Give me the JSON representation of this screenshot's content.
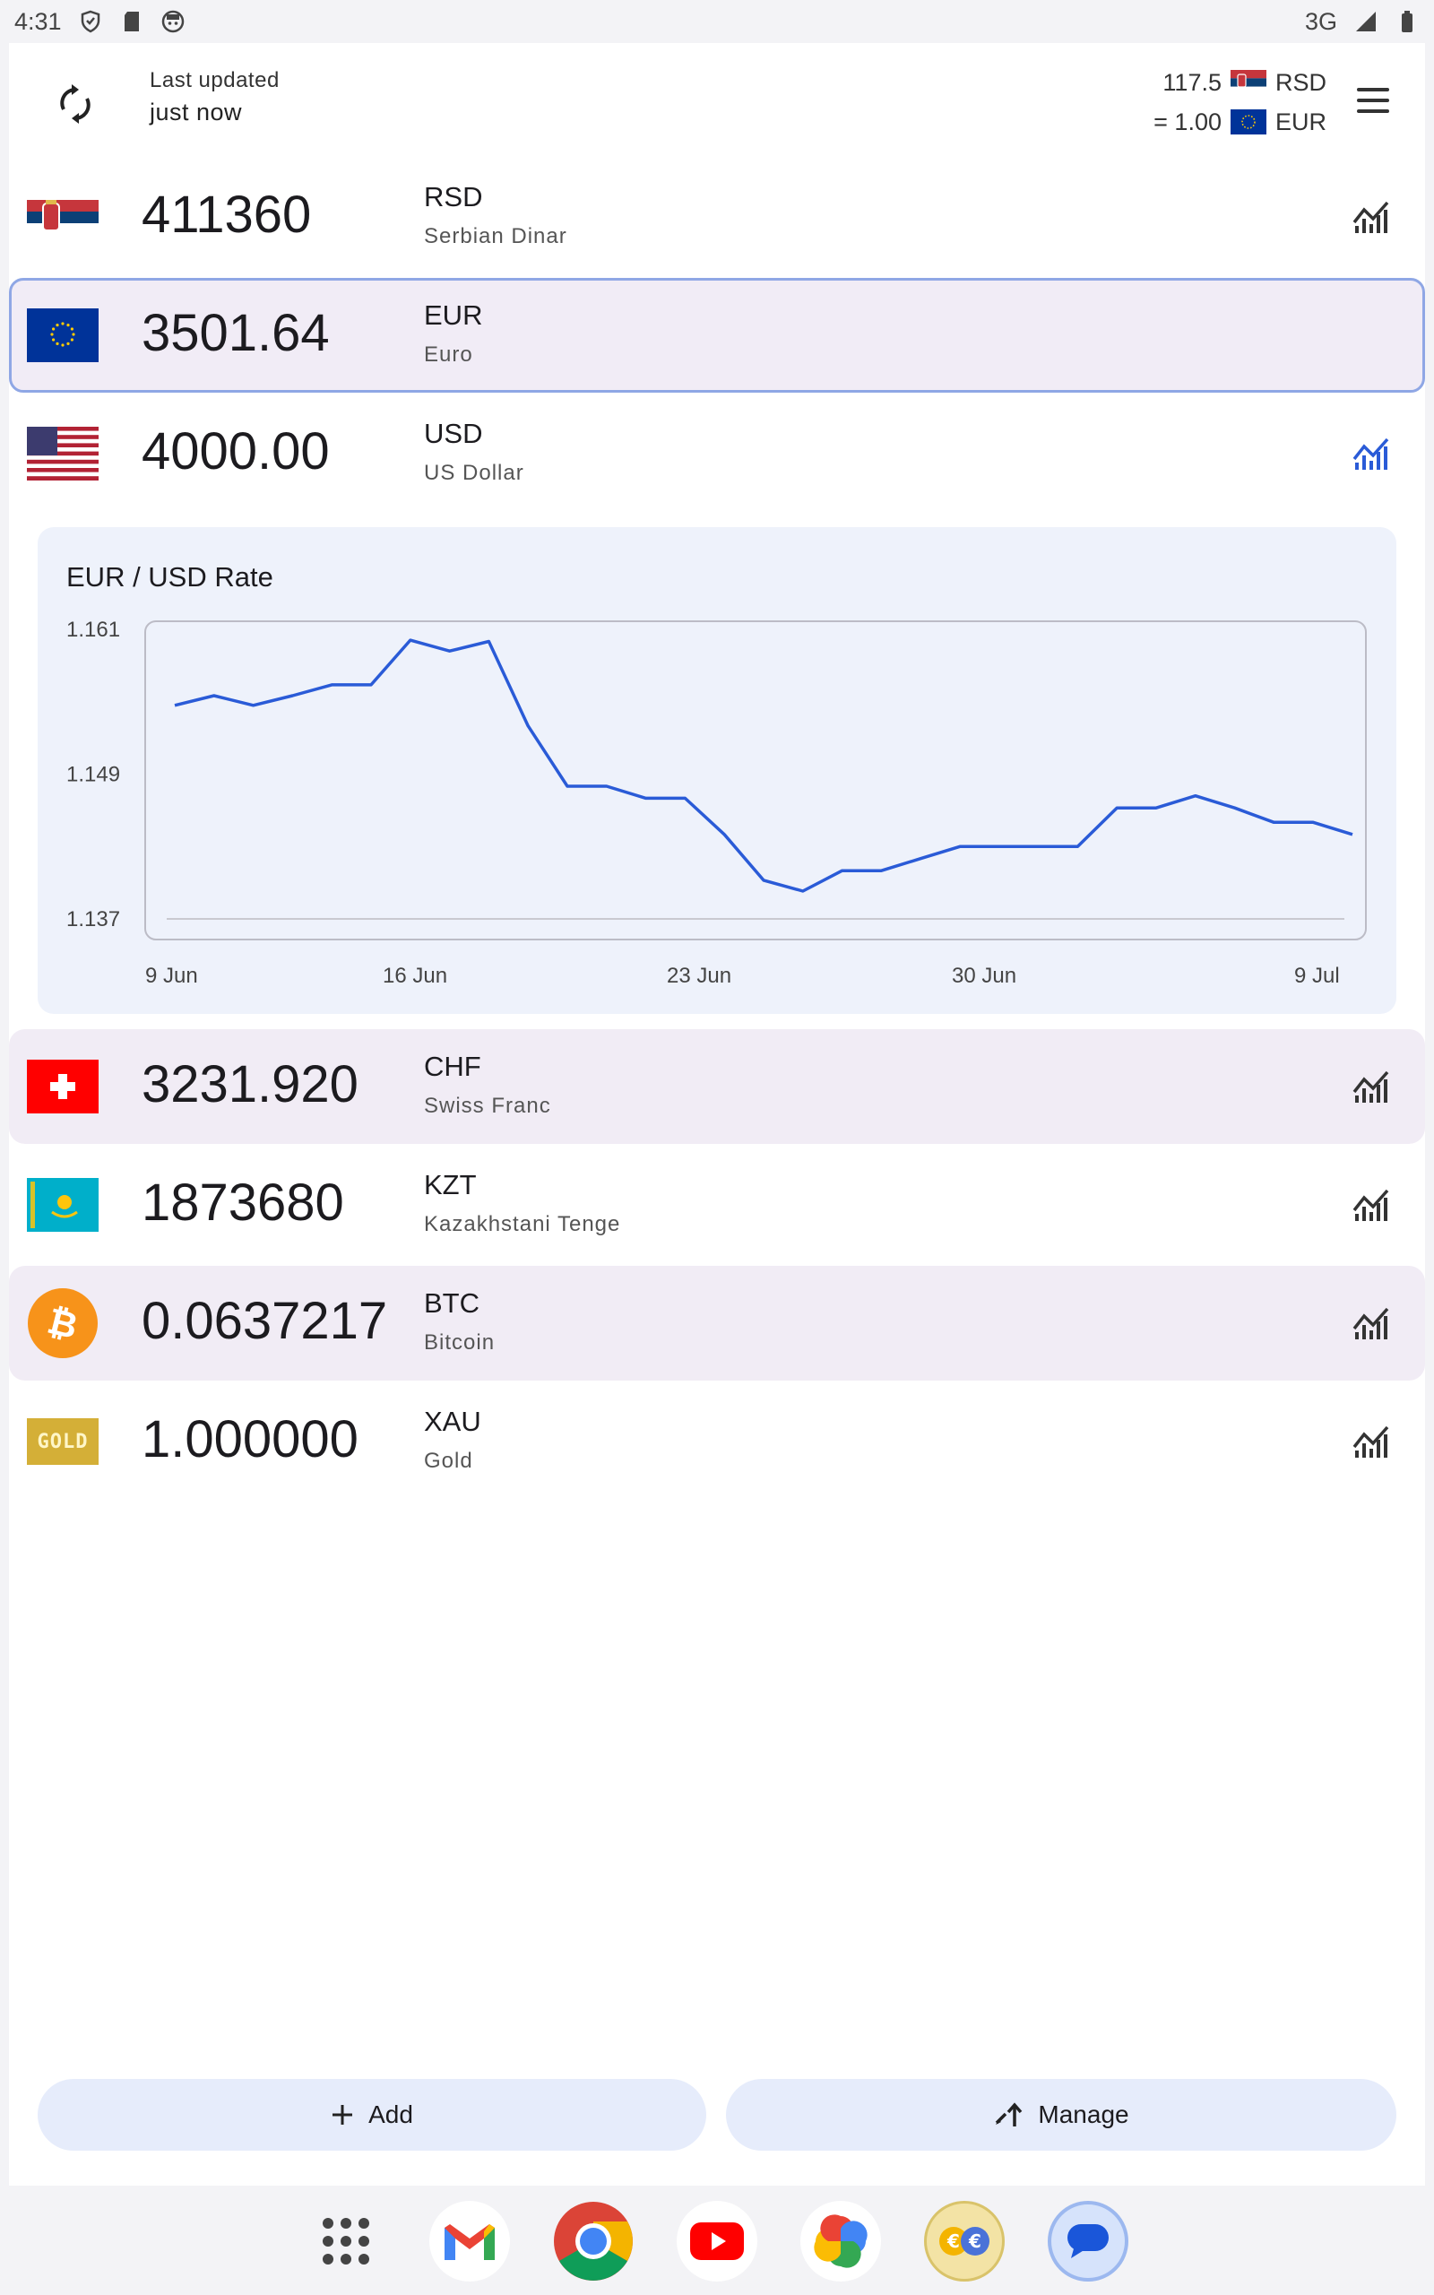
{
  "status_bar": {
    "time": "4:31",
    "network": "3G",
    "icons": [
      "shield-icon",
      "sd-card-icon",
      "face-icon",
      "signal-icon",
      "battery-icon"
    ]
  },
  "header": {
    "last_updated_label": "Last updated",
    "last_updated_value": "just now",
    "rate_top_value": "117.5",
    "rate_top_code": "RSD",
    "rate_bottom_value": "= 1.00",
    "rate_bottom_code": "EUR"
  },
  "currencies": [
    {
      "amount": "411360",
      "code": "RSD",
      "name": "Serbian Dinar",
      "flag": "serbia-flag"
    },
    {
      "amount": "3501.64",
      "code": "EUR",
      "name": "Euro",
      "flag": "eu-flag",
      "selected": true
    },
    {
      "amount": "4000.00",
      "code": "USD",
      "name": "US Dollar",
      "flag": "us-flag",
      "chart_open": true
    },
    {
      "amount": "3231.920",
      "code": "CHF",
      "name": "Swiss Franc",
      "flag": "swiss-flag"
    },
    {
      "amount": "1873680",
      "code": "KZT",
      "name": "Kazakhstani Tenge",
      "flag": "kazakhstan-flag"
    },
    {
      "amount": "0.0637217",
      "code": "BTC",
      "name": "Bitcoin",
      "flag": "bitcoin-logo"
    },
    {
      "amount": "1.000000",
      "code": "XAU",
      "name": "Gold",
      "flag": "gold-bar",
      "flag_text": "GOLD"
    }
  ],
  "chart_data": {
    "type": "line",
    "title": "EUR / USD Rate",
    "y_ticks": [
      "1.161",
      "1.149",
      "1.137"
    ],
    "x_ticks": [
      "9 Jun",
      "16 Jun",
      "23 Jun",
      "30 Jun",
      "9 Jul"
    ],
    "ylim": [
      1.137,
      1.161
    ],
    "series": [
      {
        "color": "#2a5bd7",
        "values": [
          1.1547,
          1.1555,
          1.1547,
          1.1555,
          1.1564,
          1.1564,
          1.1601,
          1.1592,
          1.16,
          1.153,
          1.148,
          1.148,
          1.147,
          1.147,
          1.144,
          1.1402,
          1.1393,
          1.141,
          1.141,
          1.142,
          1.143,
          1.143,
          1.143,
          1.143,
          1.1462,
          1.1462,
          1.1472,
          1.1462,
          1.145,
          1.145,
          1.144
        ]
      }
    ],
    "grid": false
  },
  "buttons": {
    "add_label": "Add",
    "manage_label": "Manage"
  },
  "dock": {
    "apps": [
      "app-drawer-icon",
      "gmail-icon",
      "chrome-icon",
      "youtube-icon",
      "photos-icon",
      "currency-converter-icon",
      "messages-icon"
    ]
  },
  "colors": {
    "accent": "#2a5bd7",
    "row_shade": "#f1ecf5",
    "chart_bg": "#eef2fb",
    "button_bg": "#e6ecfb"
  }
}
